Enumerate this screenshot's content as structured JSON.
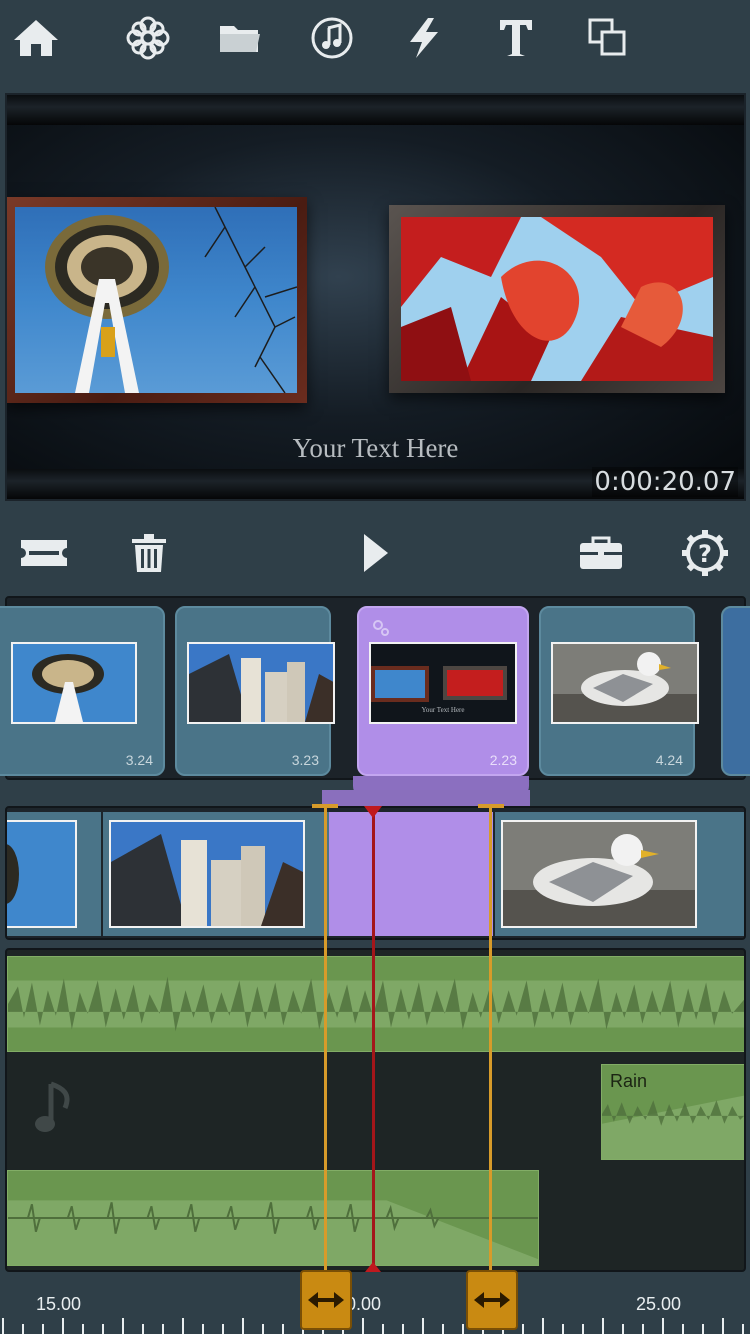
{
  "app": {
    "accent": "#b08ee8",
    "trim_color": "#d79b2a",
    "playhead_color": "#c0191e"
  },
  "toolbar": {
    "icons": [
      "home-icon",
      "flower-icon",
      "folder-icon",
      "music-icon",
      "lightning-icon",
      "text-icon",
      "layers-icon"
    ]
  },
  "preview": {
    "caption": "Your Text Here",
    "timecode": "0:00:20.07"
  },
  "controls": {
    "icons": [
      "ticket-icon",
      "trash-icon",
      "play-icon",
      "toolbox-icon",
      "help-gear-icon"
    ]
  },
  "clips": [
    {
      "duration": "3.24",
      "thumb": "space-needle"
    },
    {
      "duration": "3.23",
      "thumb": "buildings"
    },
    {
      "duration": "2.23",
      "thumb": "title-preview",
      "selected": true,
      "thumb_caption": "Your Text Here"
    },
    {
      "duration": "4.24",
      "thumb": "seagull"
    }
  ],
  "audio": {
    "clip_label": "Rain"
  },
  "ruler": {
    "labels": [
      "15.00",
      "20.00",
      "25.00"
    ]
  }
}
